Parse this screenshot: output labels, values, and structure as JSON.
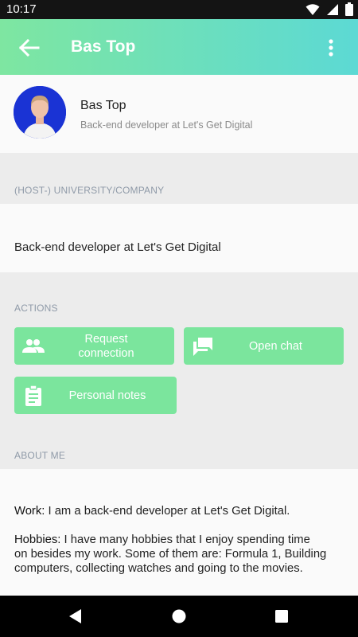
{
  "status_bar": {
    "time": "10:17"
  },
  "app_bar": {
    "title": "Bas Top"
  },
  "profile": {
    "name": "Bas Top",
    "subtitle": "Back-end developer at Let's Get Digital"
  },
  "university": {
    "label": "(HOST-) UNIVERSITY/COMPANY",
    "value": "Back-end developer at Let's Get Digital"
  },
  "actions": {
    "label": "ACTIONS",
    "request_connection_line1": "Request",
    "request_connection_line2": "connection",
    "open_chat": "Open chat",
    "personal_notes": "Personal notes"
  },
  "about": {
    "label": "ABOUT ME",
    "work_label": "Work:",
    "work_text": " I am a back-end developer at Let's Get Digital.",
    "hobbies_label": "Hobbies:",
    "hobbies_line1": " I have many hobbies that I enjoy spending time",
    "hobbies_line2": "on besides my work. Some of them are: Formula 1, Building",
    "hobbies_line3": "computers, collecting watches and going to the movies."
  },
  "colors": {
    "accent_green": "#7be59d",
    "gradient_start": "#7ee6a1",
    "gradient_end": "#5cd9d4",
    "avatar_bg": "#1a33d4"
  },
  "icons": {
    "back": "arrow-back-icon",
    "menu": "more-vert-icon",
    "people": "people-icon",
    "chat": "chat-icon",
    "notes": "clipboard-icon"
  }
}
